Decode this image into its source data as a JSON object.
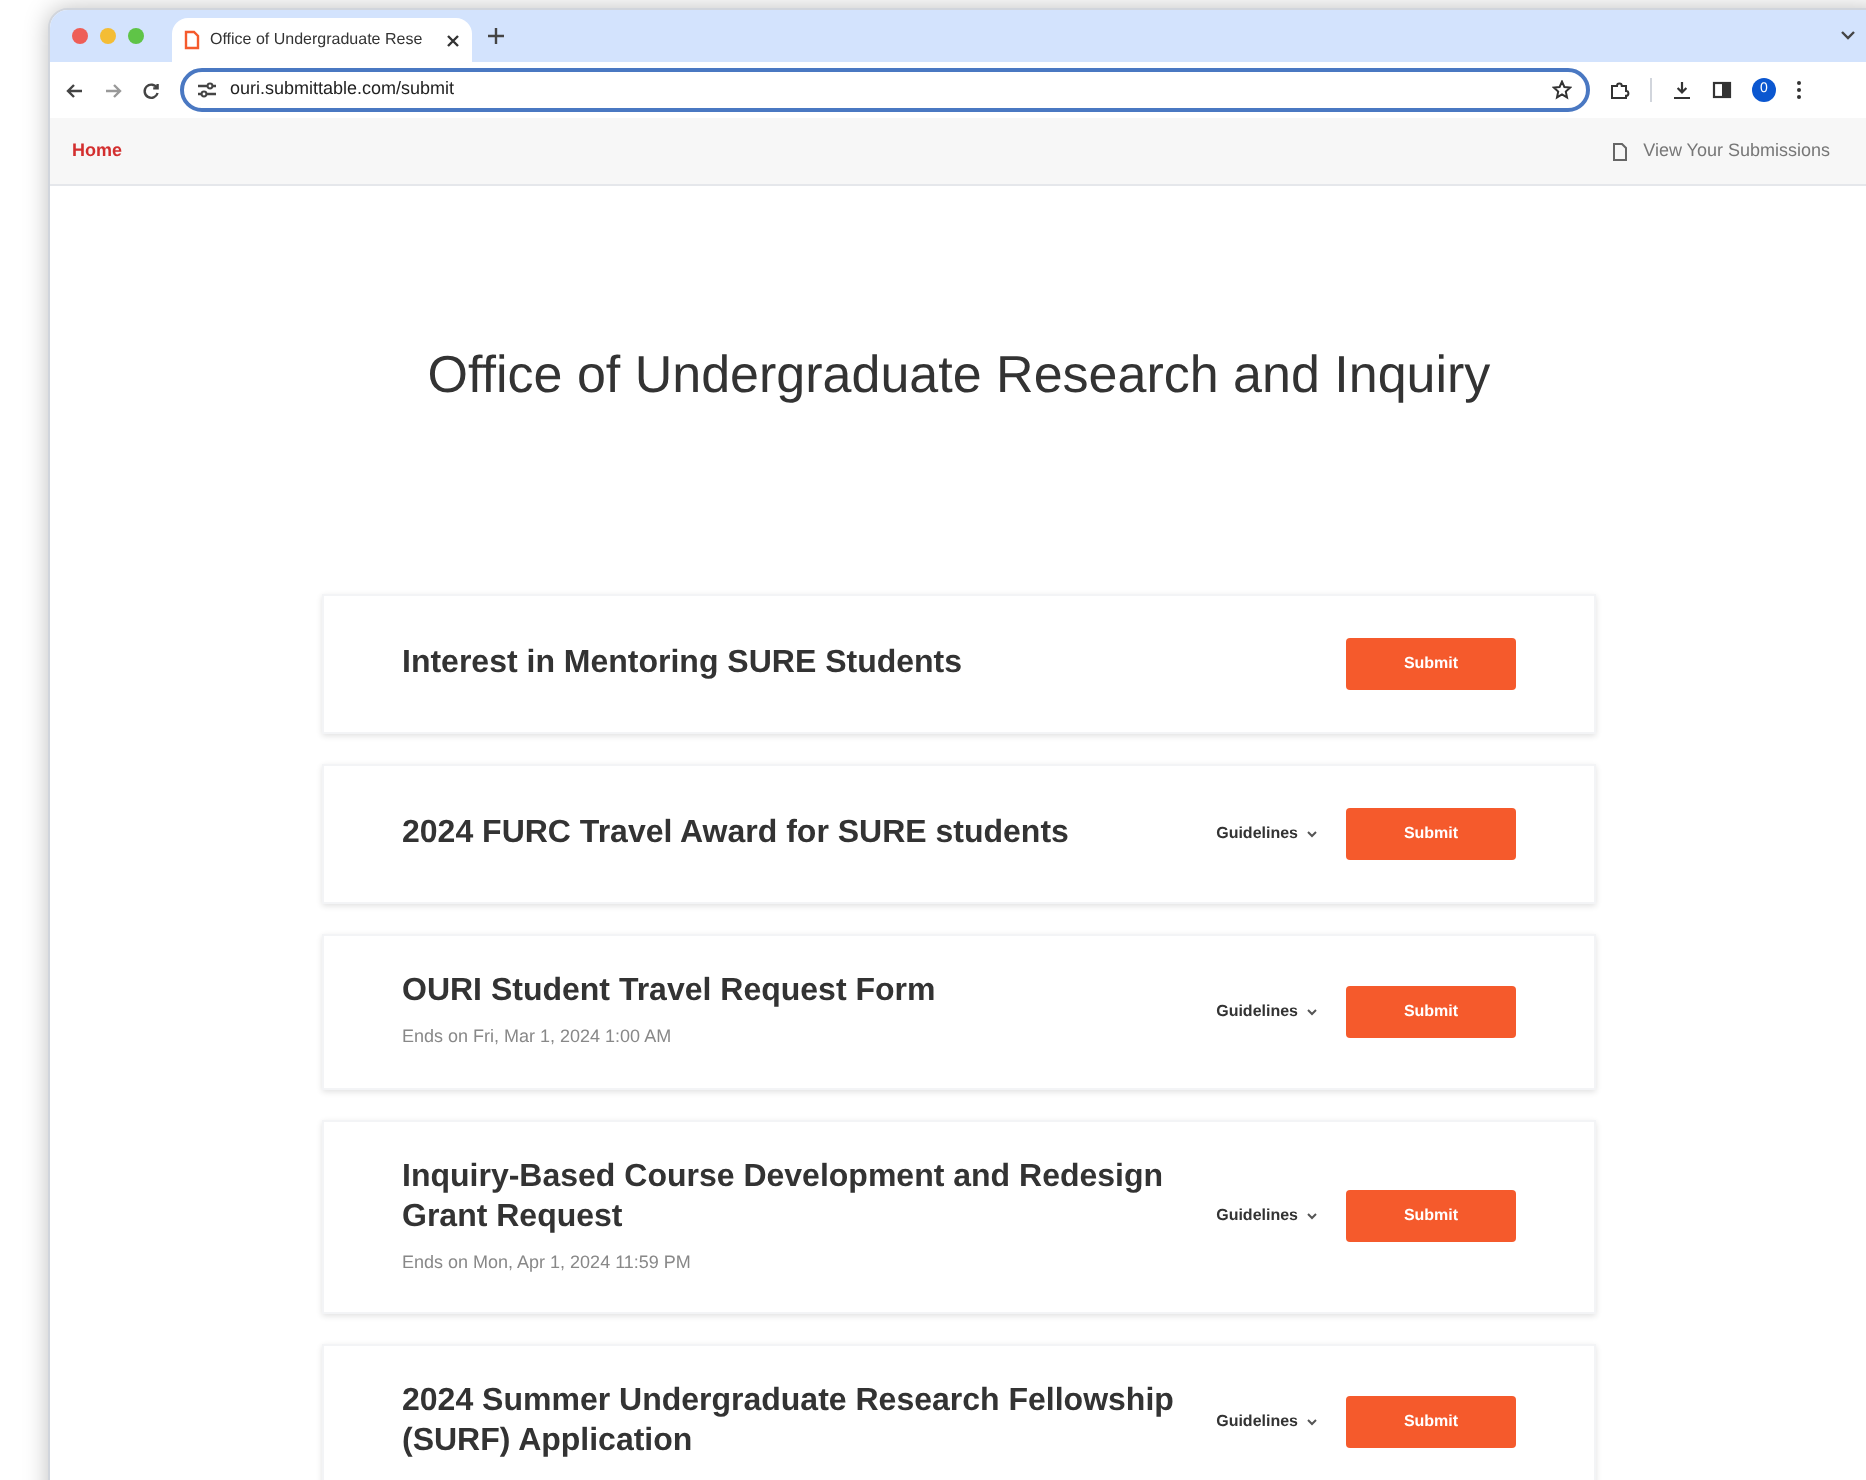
{
  "browser": {
    "tab_title": "Office of Undergraduate Rese",
    "url": "ouri.submittable.com/submit",
    "profile_initial": "0"
  },
  "nav": {
    "home": "Home",
    "submissions_link": "View Your Submissions"
  },
  "heading": "Office of Undergraduate Research and Inquiry",
  "forms": [
    {
      "title": "Interest in Mentoring SURE Students",
      "button": "Submit"
    },
    {
      "title": "2024 FURC Travel Award for SURE students",
      "guidelines": "Guidelines",
      "button": "Submit"
    },
    {
      "title": "OURI Student Travel Request Form",
      "deadline": "Ends on Fri, Mar 1, 2024 1:00 AM",
      "guidelines": "Guidelines",
      "button": "Submit"
    },
    {
      "title": "Inquiry-Based Course Development and Redesign Grant Request",
      "deadline": "Ends on Mon, Apr 1, 2024 11:59 PM",
      "guidelines": "Guidelines",
      "button": "Submit"
    },
    {
      "title": "2024 Summer Undergraduate Research Fellowship (SURF) Application",
      "guidelines": "Guidelines",
      "button": "Submit"
    }
  ]
}
